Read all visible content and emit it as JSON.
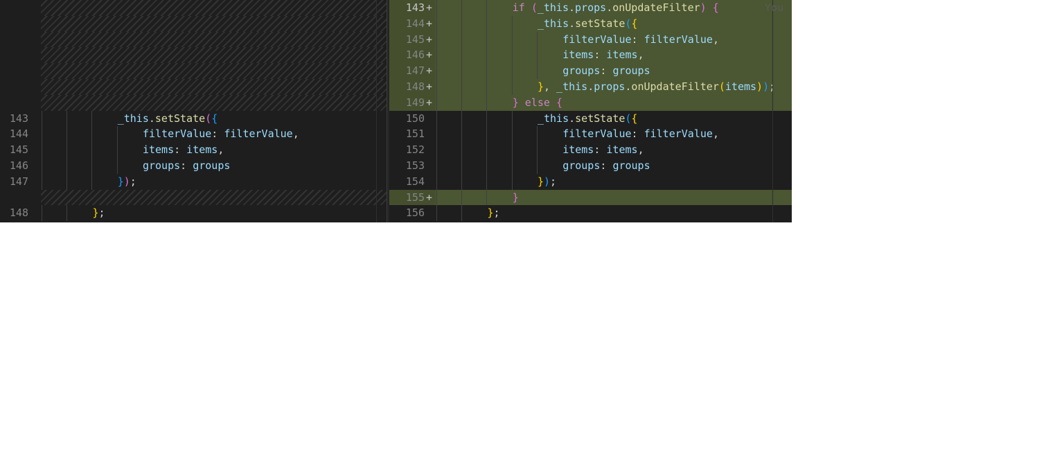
{
  "left_pane": {
    "lines": [
      {
        "kind": "filler",
        "number": "",
        "indent": 0,
        "tokens": []
      },
      {
        "kind": "filler",
        "number": "",
        "indent": 0,
        "tokens": []
      },
      {
        "kind": "filler",
        "number": "",
        "indent": 0,
        "tokens": []
      },
      {
        "kind": "filler",
        "number": "",
        "indent": 0,
        "tokens": []
      },
      {
        "kind": "filler",
        "number": "",
        "indent": 0,
        "tokens": []
      },
      {
        "kind": "filler",
        "number": "",
        "indent": 0,
        "tokens": []
      },
      {
        "kind": "filler",
        "number": "",
        "indent": 0,
        "tokens": []
      },
      {
        "kind": "normal",
        "number": "143",
        "indent": 3,
        "tokens": [
          [
            "v",
            "_this"
          ],
          [
            "p",
            "."
          ],
          [
            "f",
            "setState"
          ],
          [
            "b2",
            "("
          ],
          [
            "b3",
            "{"
          ]
        ]
      },
      {
        "kind": "normal",
        "number": "144",
        "indent": 4,
        "tokens": [
          [
            "v",
            "filterValue"
          ],
          [
            "p",
            ": "
          ],
          [
            "v",
            "filterValue"
          ],
          [
            "p",
            ","
          ]
        ]
      },
      {
        "kind": "normal",
        "number": "145",
        "indent": 4,
        "tokens": [
          [
            "v",
            "items"
          ],
          [
            "p",
            ": "
          ],
          [
            "v",
            "items"
          ],
          [
            "p",
            ","
          ]
        ]
      },
      {
        "kind": "normal",
        "number": "146",
        "indent": 4,
        "tokens": [
          [
            "v",
            "groups"
          ],
          [
            "p",
            ": "
          ],
          [
            "v",
            "groups"
          ]
        ]
      },
      {
        "kind": "normal",
        "number": "147",
        "indent": 3,
        "tokens": [
          [
            "b3",
            "}"
          ],
          [
            "b2",
            ")"
          ],
          [
            "p",
            ";"
          ]
        ]
      },
      {
        "kind": "filler",
        "number": "",
        "indent": 0,
        "tokens": []
      },
      {
        "kind": "normal",
        "number": "148",
        "indent": 2,
        "tokens": [
          [
            "b1",
            "}"
          ],
          [
            "p",
            ";"
          ]
        ]
      }
    ]
  },
  "right_pane": {
    "lines": [
      {
        "kind": "added",
        "number": "143",
        "current": true,
        "indent": 3,
        "tokens": [
          [
            "k",
            "if "
          ],
          [
            "b2",
            "("
          ],
          [
            "v",
            "_this"
          ],
          [
            "p",
            "."
          ],
          [
            "v",
            "props"
          ],
          [
            "p",
            "."
          ],
          [
            "f",
            "onUpdateFilter"
          ],
          [
            "b2",
            ")"
          ],
          [
            "p",
            " "
          ],
          [
            "b2",
            "{"
          ]
        ]
      },
      {
        "kind": "added",
        "number": "144",
        "indent": 4,
        "tokens": [
          [
            "v",
            "_this"
          ],
          [
            "p",
            "."
          ],
          [
            "f",
            "setState"
          ],
          [
            "b3",
            "("
          ],
          [
            "b1",
            "{"
          ]
        ]
      },
      {
        "kind": "added",
        "number": "145",
        "indent": 5,
        "tokens": [
          [
            "v",
            "filterValue"
          ],
          [
            "p",
            ": "
          ],
          [
            "v",
            "filterValue"
          ],
          [
            "p",
            ","
          ]
        ]
      },
      {
        "kind": "added",
        "number": "146",
        "indent": 5,
        "tokens": [
          [
            "v",
            "items"
          ],
          [
            "p",
            ": "
          ],
          [
            "v",
            "items"
          ],
          [
            "p",
            ","
          ]
        ]
      },
      {
        "kind": "added",
        "number": "147",
        "indent": 5,
        "tokens": [
          [
            "v",
            "groups"
          ],
          [
            "p",
            ": "
          ],
          [
            "v",
            "groups"
          ]
        ]
      },
      {
        "kind": "added",
        "number": "148",
        "indent": 4,
        "tokens": [
          [
            "b1",
            "}"
          ],
          [
            "p",
            ", "
          ],
          [
            "v",
            "_this"
          ],
          [
            "p",
            "."
          ],
          [
            "v",
            "props"
          ],
          [
            "p",
            "."
          ],
          [
            "f",
            "onUpdateFilter"
          ],
          [
            "b1",
            "("
          ],
          [
            "v",
            "items"
          ],
          [
            "b1",
            ")"
          ],
          [
            "b3",
            ")"
          ],
          [
            "p",
            ";"
          ]
        ]
      },
      {
        "kind": "added",
        "number": "149",
        "indent": 3,
        "tokens": [
          [
            "b2",
            "}"
          ],
          [
            "k",
            " else "
          ],
          [
            "b2",
            "{"
          ]
        ]
      },
      {
        "kind": "normal",
        "number": "150",
        "indent": 4,
        "tokens": [
          [
            "v",
            "_this"
          ],
          [
            "p",
            "."
          ],
          [
            "f",
            "setState"
          ],
          [
            "b3",
            "("
          ],
          [
            "b1",
            "{"
          ]
        ]
      },
      {
        "kind": "normal",
        "number": "151",
        "indent": 5,
        "tokens": [
          [
            "v",
            "filterValue"
          ],
          [
            "p",
            ": "
          ],
          [
            "v",
            "filterValue"
          ],
          [
            "p",
            ","
          ]
        ]
      },
      {
        "kind": "normal",
        "number": "152",
        "indent": 5,
        "tokens": [
          [
            "v",
            "items"
          ],
          [
            "p",
            ": "
          ],
          [
            "v",
            "items"
          ],
          [
            "p",
            ","
          ]
        ]
      },
      {
        "kind": "normal",
        "number": "153",
        "indent": 5,
        "tokens": [
          [
            "v",
            "groups"
          ],
          [
            "p",
            ": "
          ],
          [
            "v",
            "groups"
          ]
        ]
      },
      {
        "kind": "normal",
        "number": "154",
        "indent": 4,
        "tokens": [
          [
            "b1",
            "}"
          ],
          [
            "b3",
            ")"
          ],
          [
            "p",
            ";"
          ]
        ]
      },
      {
        "kind": "added",
        "number": "155",
        "indent": 3,
        "tokens": [
          [
            "b2",
            "}"
          ]
        ]
      },
      {
        "kind": "normal",
        "number": "156",
        "indent": 2,
        "tokens": [
          [
            "b1",
            "}"
          ],
          [
            "p",
            ";"
          ]
        ]
      }
    ],
    "added_marker": "+",
    "blame_hint": "You"
  },
  "colors": {
    "editor_bg": "#1e1e1e",
    "added_line_bg": "#4b5632",
    "line_number": "#858585",
    "keyword": "#c586c0",
    "variable": "#9cdcfe",
    "function": "#dcdcaa",
    "bracket_gold": "#ffd700",
    "bracket_orchid": "#da70d6",
    "bracket_blue": "#179fff"
  }
}
